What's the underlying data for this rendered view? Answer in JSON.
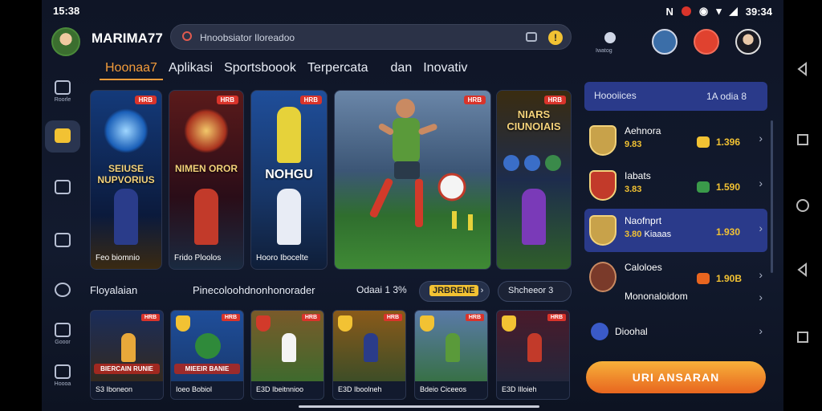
{
  "status": {
    "time": "15:38",
    "right": "39:34"
  },
  "header": {
    "brand": "MARIMA77",
    "search_placeholder": "Hnoobsiator Iloreadoo",
    "search_badge": "!",
    "right_icon_label": "Iwatog"
  },
  "tabs": [
    {
      "label": "Hoonaa7",
      "active": true
    },
    {
      "label": "Aplikasi",
      "active": false
    },
    {
      "label": "Sportsboook",
      "active": false
    },
    {
      "label": "Terpercata",
      "active": false
    },
    {
      "label": "dan",
      "active": false
    },
    {
      "label": "Inovativ",
      "active": false
    }
  ],
  "rail": [
    {
      "label": "Roorle"
    },
    {
      "label": ""
    },
    {
      "label": ""
    },
    {
      "label": ""
    },
    {
      "label": ""
    },
    {
      "label": "Gooor"
    },
    {
      "label": "Hoooa"
    }
  ],
  "featured": [
    {
      "tag": "HRB",
      "title": "SEIUSE NUPVORIUS",
      "caption": "Feo biomnio"
    },
    {
      "tag": "HRB",
      "title": "NIMEN OROR",
      "caption": "Frido Ploolos"
    },
    {
      "tag": "HRB",
      "title": "NOHGU",
      "caption": "Hooro Ibocelte"
    },
    {
      "tag": "HRB",
      "title": "",
      "caption": ""
    },
    {
      "tag": "HRB",
      "title": "NIARS CIUNOIAIS",
      "caption": ""
    }
  ],
  "section": {
    "left": "Floyalaian",
    "mid": "Pinecoloohdnonhonorader",
    "right": "Odaai 1 3%",
    "pill_a": "JRBRENE",
    "pill_b": "Shcheeor",
    "pill_b_num": "3"
  },
  "small_cards": [
    {
      "tag": "HRB",
      "title": "BIERCAIN RUNIE",
      "caption": "S3 Iboneon"
    },
    {
      "tag": "HRB",
      "title": "MIEEIR BANIE",
      "caption": "Ioeo Bobiol"
    },
    {
      "tag": "HRB",
      "title": "",
      "caption": "E3D Ibeitnnioo"
    },
    {
      "tag": "HRB",
      "title": "",
      "caption": "E3D Iboolneh"
    },
    {
      "tag": "HRB",
      "title": "",
      "caption": "Bdeio Ciceeos"
    },
    {
      "tag": "HRB",
      "title": "",
      "caption": "E3D Illoieh"
    }
  ],
  "panel": {
    "head_left": "Hoooiices",
    "head_right": "1A odia 8",
    "rows": [
      {
        "name": "Aehnora",
        "sub": "9.83",
        "sub_word": "",
        "value": "1.396",
        "highlight": false
      },
      {
        "name": "Iabats",
        "sub": "3.83",
        "sub_word": "",
        "value": "1.590",
        "highlight": false
      },
      {
        "name": "Naofnprt",
        "sub": "3.80",
        "sub_word": "Kiaaas",
        "value": "1.930",
        "highlight": true
      },
      {
        "name": "Caloloes",
        "sub": "",
        "sub_word": "",
        "value": "1.90B",
        "highlight": false
      },
      {
        "name": "Mononaloidom",
        "sub": "",
        "sub_word": "",
        "value": "",
        "highlight": false
      },
      {
        "name": "Dioohal",
        "sub": "",
        "sub_word": "",
        "value": "",
        "highlight": false
      }
    ],
    "cta": "URI ANSARAN"
  },
  "colors": {
    "accent": "#f39b3a",
    "gold": "#f2c233",
    "panel_highlight": "#2a3a8a",
    "danger": "#d9342b"
  }
}
